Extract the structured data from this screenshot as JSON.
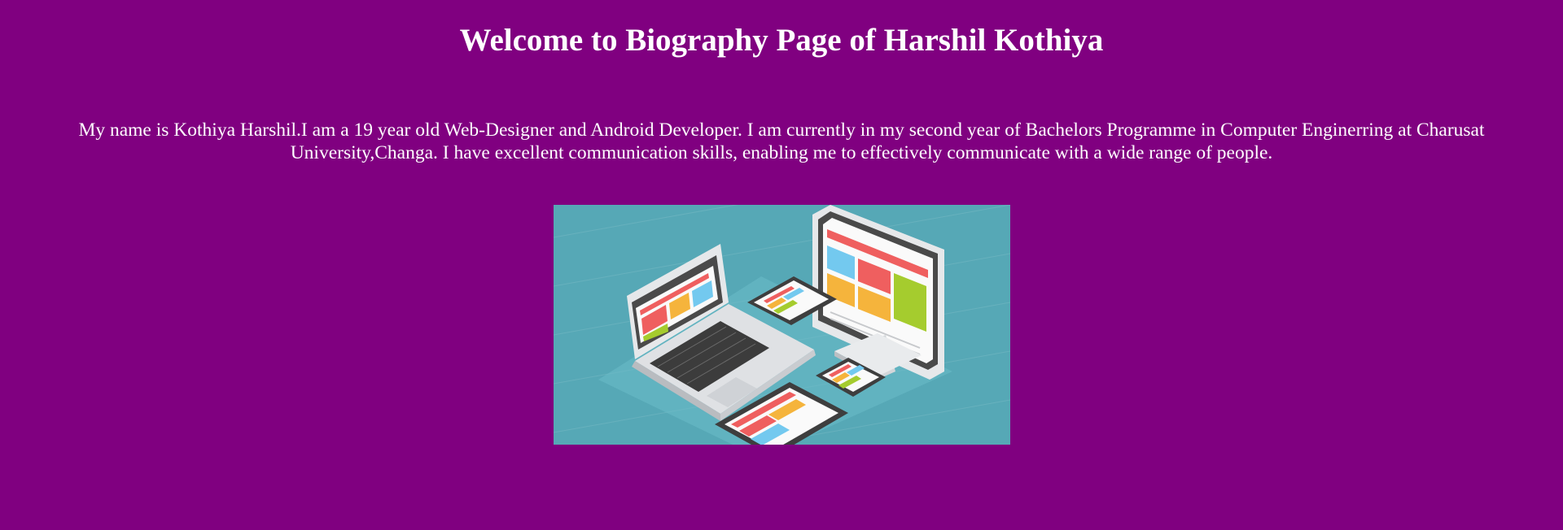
{
  "page": {
    "background_color": "#800080",
    "text_color": "#ffffff",
    "title": "Welcome to Biography Page of Harshil Kothiya",
    "bio": "My name is Kothiya Harshil.I am a 19 year old Web-Designer and Android Developer. I am currently in my second year of Bachelors Programme in Computer Enginerring at Charusat University,Changa. I have excellent communication skills, enabling me to effectively communicate with a wide range of people."
  },
  "illustration": {
    "icon": "responsive-devices-illustration",
    "colors": {
      "background": "#56a8b6",
      "tile_red": "#ef5f5f",
      "tile_orange": "#f5b43c",
      "tile_blue": "#73c9ef",
      "tile_green": "#a5cc2e",
      "device_body": "#e6e8ea",
      "screen_frame": "#4a4a4a"
    }
  }
}
